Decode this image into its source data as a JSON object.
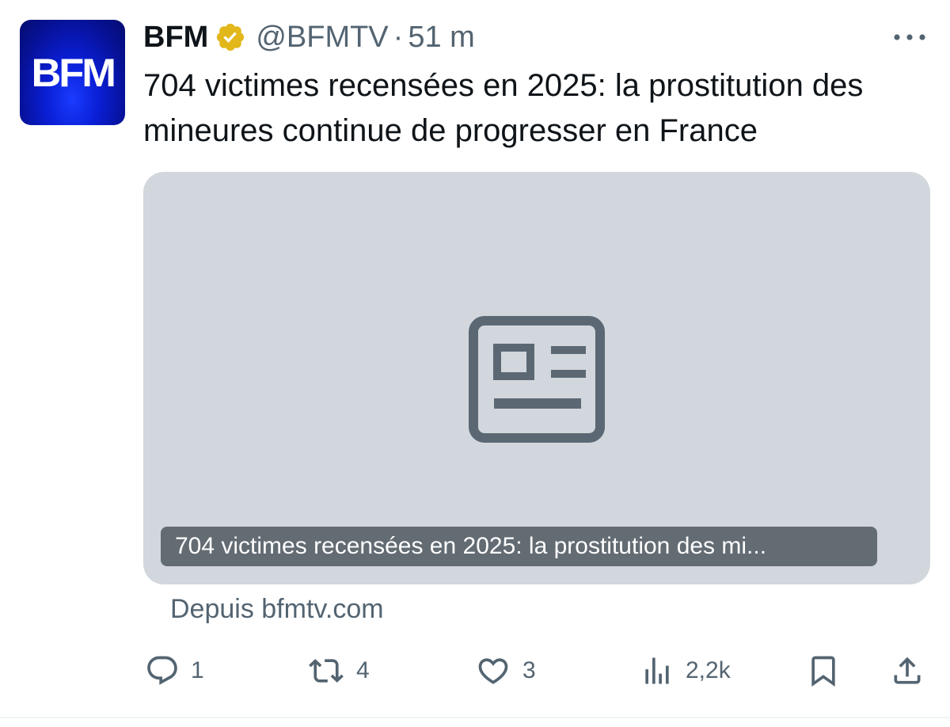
{
  "author": {
    "name": "BFM",
    "handle": "@BFMTV",
    "separator": "·",
    "time": "51 m",
    "avatar_text": "BFM",
    "verified_color": "#e2b719"
  },
  "tweet": {
    "text": "704 victimes recensées en 2025: la prostitution des mineures continue de progresser en France"
  },
  "card": {
    "title": "704 victimes recensées en 2025: la prostitution des mi...",
    "icon": "article-icon",
    "background": "#d1d7dc"
  },
  "source": {
    "text": "Depuis bfmtv.com"
  },
  "actions": {
    "reply_count": "1",
    "retweet_count": "4",
    "like_count": "3",
    "views_count": "2,2k"
  },
  "colors": {
    "text": "#0f1419",
    "secondary": "#536471"
  }
}
